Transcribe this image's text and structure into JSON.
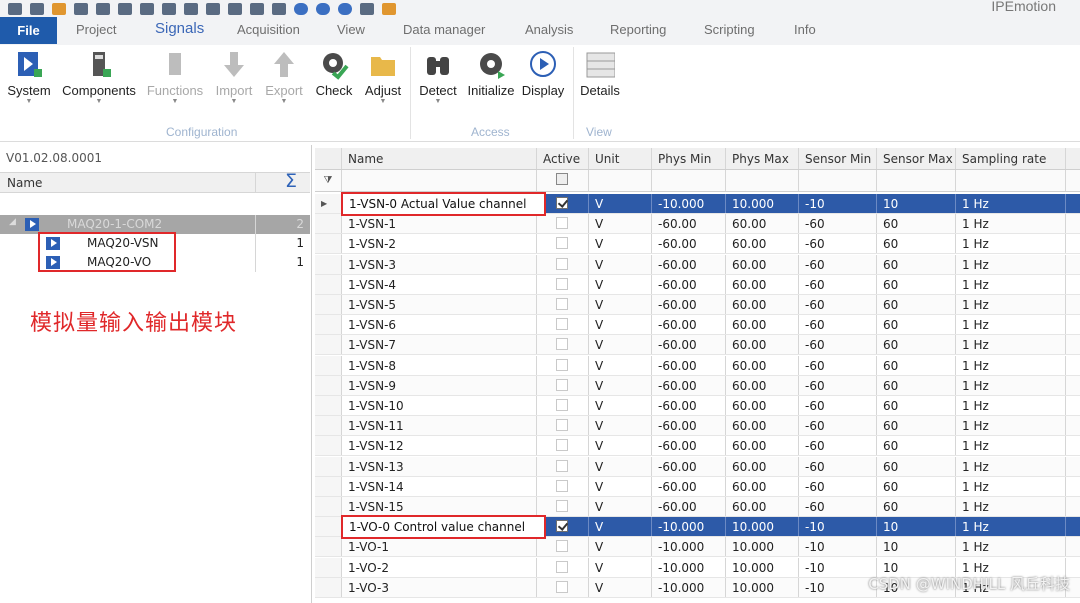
{
  "app": {
    "title": "IPEmotion"
  },
  "quick_access": [
    "app-icon",
    "new-icon",
    "open-icon",
    "save-icon",
    "save-as-icon",
    "print-icon",
    "cut-icon",
    "copy-icon",
    "paste-icon",
    "undo-icon",
    "redo-icon",
    "delete-icon",
    "tools-icon",
    "settings-icon",
    "help-icon",
    "info-icon",
    "options-icon",
    "user-icon",
    "dropdown-icon"
  ],
  "tabs": [
    "File",
    "Project",
    "Signals",
    "Acquisition",
    "View",
    "Data manager",
    "Analysis",
    "Reporting",
    "Scripting",
    "Info"
  ],
  "active_tab": "Signals",
  "ribbon": {
    "configuration": {
      "label": "Configuration",
      "buttons": [
        "System",
        "Components",
        "Functions",
        "Import",
        "Export",
        "Check",
        "Adjust"
      ]
    },
    "access": {
      "label": "Access",
      "buttons": [
        "Detect",
        "Initialize",
        "Display"
      ]
    },
    "view": {
      "label": "View",
      "buttons": [
        "Details"
      ]
    }
  },
  "left_panel": {
    "version": "V01.02.08.0001",
    "header_name": "Name",
    "sum_symbol": "Σ",
    "tree": [
      {
        "label": "MAQ20-1-COM2",
        "count": "2"
      },
      {
        "label": "MAQ20-VSN",
        "count": "1"
      },
      {
        "label": "MAQ20-VO",
        "count": "1"
      }
    ],
    "annotation": "模拟量输入输出模块"
  },
  "grid": {
    "columns": [
      "Name",
      "Active",
      "Unit",
      "Phys Min",
      "Phys Max",
      "Sensor Min",
      "Sensor Max",
      "Sampling rate"
    ],
    "rows": [
      {
        "name": "1-VSN-0 Actual Value channel",
        "active": true,
        "unit": "V",
        "phys_min": "-10.000",
        "phys_max": "10.000",
        "sensor_min": "-10",
        "sensor_max": "10",
        "rate": "1 Hz"
      },
      {
        "name": "1-VSN-1",
        "active": false,
        "unit": "V",
        "phys_min": "-60.00",
        "phys_max": "60.00",
        "sensor_min": "-60",
        "sensor_max": "60",
        "rate": "1 Hz"
      },
      {
        "name": "1-VSN-2",
        "active": false,
        "unit": "V",
        "phys_min": "-60.00",
        "phys_max": "60.00",
        "sensor_min": "-60",
        "sensor_max": "60",
        "rate": "1 Hz"
      },
      {
        "name": "1-VSN-3",
        "active": false,
        "unit": "V",
        "phys_min": "-60.00",
        "phys_max": "60.00",
        "sensor_min": "-60",
        "sensor_max": "60",
        "rate": "1 Hz"
      },
      {
        "name": "1-VSN-4",
        "active": false,
        "unit": "V",
        "phys_min": "-60.00",
        "phys_max": "60.00",
        "sensor_min": "-60",
        "sensor_max": "60",
        "rate": "1 Hz"
      },
      {
        "name": "1-VSN-5",
        "active": false,
        "unit": "V",
        "phys_min": "-60.00",
        "phys_max": "60.00",
        "sensor_min": "-60",
        "sensor_max": "60",
        "rate": "1 Hz"
      },
      {
        "name": "1-VSN-6",
        "active": false,
        "unit": "V",
        "phys_min": "-60.00",
        "phys_max": "60.00",
        "sensor_min": "-60",
        "sensor_max": "60",
        "rate": "1 Hz"
      },
      {
        "name": "1-VSN-7",
        "active": false,
        "unit": "V",
        "phys_min": "-60.00",
        "phys_max": "60.00",
        "sensor_min": "-60",
        "sensor_max": "60",
        "rate": "1 Hz"
      },
      {
        "name": "1-VSN-8",
        "active": false,
        "unit": "V",
        "phys_min": "-60.00",
        "phys_max": "60.00",
        "sensor_min": "-60",
        "sensor_max": "60",
        "rate": "1 Hz"
      },
      {
        "name": "1-VSN-9",
        "active": false,
        "unit": "V",
        "phys_min": "-60.00",
        "phys_max": "60.00",
        "sensor_min": "-60",
        "sensor_max": "60",
        "rate": "1 Hz"
      },
      {
        "name": "1-VSN-10",
        "active": false,
        "unit": "V",
        "phys_min": "-60.00",
        "phys_max": "60.00",
        "sensor_min": "-60",
        "sensor_max": "60",
        "rate": "1 Hz"
      },
      {
        "name": "1-VSN-11",
        "active": false,
        "unit": "V",
        "phys_min": "-60.00",
        "phys_max": "60.00",
        "sensor_min": "-60",
        "sensor_max": "60",
        "rate": "1 Hz"
      },
      {
        "name": "1-VSN-12",
        "active": false,
        "unit": "V",
        "phys_min": "-60.00",
        "phys_max": "60.00",
        "sensor_min": "-60",
        "sensor_max": "60",
        "rate": "1 Hz"
      },
      {
        "name": "1-VSN-13",
        "active": false,
        "unit": "V",
        "phys_min": "-60.00",
        "phys_max": "60.00",
        "sensor_min": "-60",
        "sensor_max": "60",
        "rate": "1 Hz"
      },
      {
        "name": "1-VSN-14",
        "active": false,
        "unit": "V",
        "phys_min": "-60.00",
        "phys_max": "60.00",
        "sensor_min": "-60",
        "sensor_max": "60",
        "rate": "1 Hz"
      },
      {
        "name": "1-VSN-15",
        "active": false,
        "unit": "V",
        "phys_min": "-60.00",
        "phys_max": "60.00",
        "sensor_min": "-60",
        "sensor_max": "60",
        "rate": "1 Hz"
      },
      {
        "name": "1-VO-0 Control value channel",
        "active": true,
        "unit": "V",
        "phys_min": "-10.000",
        "phys_max": "10.000",
        "sensor_min": "-10",
        "sensor_max": "10",
        "rate": "1 Hz"
      },
      {
        "name": "1-VO-1",
        "active": false,
        "unit": "V",
        "phys_min": "-10.000",
        "phys_max": "10.000",
        "sensor_min": "-10",
        "sensor_max": "10",
        "rate": "1 Hz"
      },
      {
        "name": "1-VO-2",
        "active": false,
        "unit": "V",
        "phys_min": "-10.000",
        "phys_max": "10.000",
        "sensor_min": "-10",
        "sensor_max": "10",
        "rate": "1 Hz"
      },
      {
        "name": "1-VO-3",
        "active": false,
        "unit": "V",
        "phys_min": "-10.000",
        "phys_max": "10.000",
        "sensor_min": "-10",
        "sensor_max": "10",
        "rate": "1 Hz"
      }
    ]
  },
  "watermark": "CSDN @WINDHILL 风丘科技",
  "colors": {
    "accent": "#1f5bab",
    "selection": "#2d5aa8",
    "annotation": "#e0282a"
  }
}
